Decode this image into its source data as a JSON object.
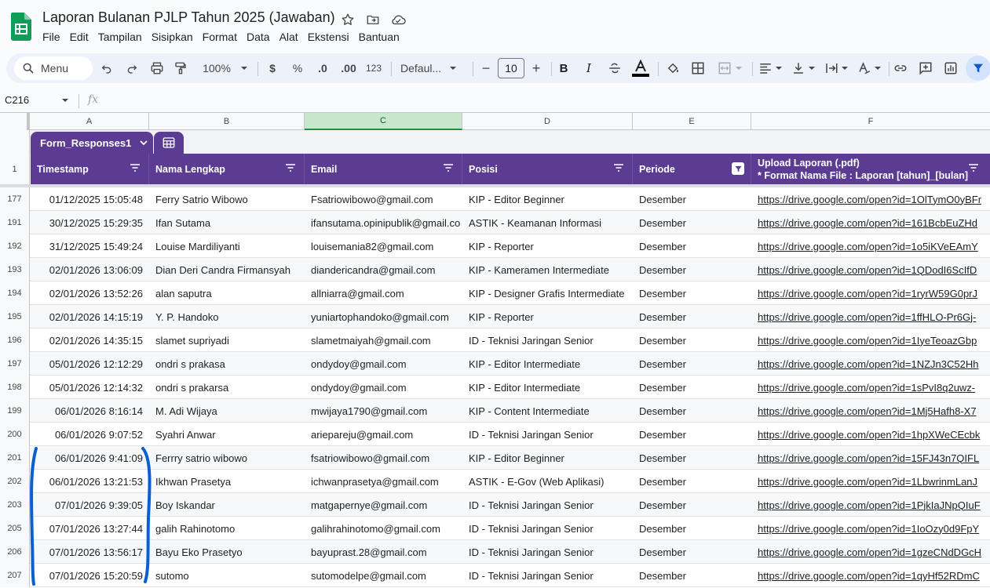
{
  "doc": {
    "title": "Laporan Bulanan PJLP Tahun 2025 (Jawaban)",
    "title_icons": [
      "star-icon",
      "move-folder-icon",
      "cloud-status-icon"
    ]
  },
  "menu": [
    "File",
    "Edit",
    "Tampilan",
    "Sisipkan",
    "Format",
    "Data",
    "Alat",
    "Ekstensi",
    "Bantuan"
  ],
  "toolbar": {
    "search_label": "Menu",
    "zoom": "100%",
    "currency": "$",
    "percent": "%",
    "decrease_decimal": ".0",
    "increase_decimal": ".00",
    "more_formats": "123",
    "font": "Defaul...",
    "font_size": "10",
    "minus": "−",
    "plus": "+",
    "bold": "B",
    "italic": "I"
  },
  "formula_bar": {
    "cell_ref": "C216",
    "fx": "fx",
    "value": ""
  },
  "columns": [
    "A",
    "B",
    "C",
    "D",
    "E",
    "F"
  ],
  "selected_column": "C",
  "table": {
    "name": "Form_Responses1",
    "header_row_number": "1",
    "headers": [
      "Timestamp",
      "Nama Lengkap",
      "Email",
      "Posisi",
      "Periode"
    ],
    "upload_header_line1": "Upload Laporan (.pdf)",
    "upload_header_line2": "* Format Nama File : Laporan [tahun]_[bulan]",
    "filtered_column": "Periode"
  },
  "rows": [
    {
      "n": "177",
      "ts": "01/12/2025 15:05:48",
      "name": "Ferry Satrio Wibowo",
      "email": "Fsatriowibowo@gmail.com",
      "pos": "KIP - Editor Beginner",
      "period": "Desember",
      "link": "https://drive.google.com/open?id=1OlTymO0yBFr"
    },
    {
      "n": "191",
      "ts": "30/12/2025 15:29:35",
      "name": "Ifan Sutama",
      "email": "ifansutama.opinipublik@gmail.co",
      "pos": "ASTIK - Keamanan Informasi",
      "period": "Desember",
      "link": "https://drive.google.com/open?id=161BcbEuZHd"
    },
    {
      "n": "192",
      "ts": "31/12/2025 15:49:24",
      "name": "Louise Mardiliyanti",
      "email": "louisemania82@gmail.com",
      "pos": "KIP - Reporter",
      "period": "Desember",
      "link": "https://drive.google.com/open?id=1o5iKVeEAmY"
    },
    {
      "n": "193",
      "ts": "02/01/2026 13:06:09",
      "name": "Dian Deri Candra Firmansyah",
      "email": "diandericandra@gmail.com",
      "pos": "KIP - Kameramen Intermediate",
      "period": "Desember",
      "link": "https://drive.google.com/open?id=1QDodI6ScIfD"
    },
    {
      "n": "194",
      "ts": "02/01/2026 13:52:26",
      "name": "alan saputra",
      "email": "allniarra@gmail.com",
      "pos": "KIP - Designer Grafis Intermediate",
      "period": "Desember",
      "link": "https://drive.google.com/open?id=1ryrW59G0prJ"
    },
    {
      "n": "195",
      "ts": "02/01/2026 14:15:19",
      "name": "Y. P. Handoko",
      "email": "yuniartophandoko@gmail.com",
      "pos": "KIP - Reporter",
      "period": "Desember",
      "link": "https://drive.google.com/open?id=1ffHLO-Pr6Gj-"
    },
    {
      "n": "196",
      "ts": "02/01/2026 14:35:15",
      "name": "slamet supriyadi",
      "email": "slametmaiyah@gmail.com",
      "pos": "ID - Teknisi Jaringan Senior",
      "period": "Desember",
      "link": "https://drive.google.com/open?id=1IyeTeoazGbp"
    },
    {
      "n": "197",
      "ts": "05/01/2026 12:12:29",
      "name": "ondri s prakasa",
      "email": "ondydoy@gmail.com",
      "pos": "KIP - Editor Intermediate",
      "period": "Desember",
      "link": "https://drive.google.com/open?id=1NZJn3C52Hh"
    },
    {
      "n": "198",
      "ts": "05/01/2026 12:14:32",
      "name": "ondri s prakarsa",
      "email": "ondydoy@gmail.com",
      "pos": "KIP - Editor Intermediate",
      "period": "Desember",
      "link": "https://drive.google.com/open?id=1sPvI8q2uwz-"
    },
    {
      "n": "199",
      "ts": "06/01/2026 8:16:14",
      "name": "M. Adi Wijaya",
      "email": "mwijaya1790@gmail.com",
      "pos": "KIP - Content Intermediate",
      "period": "Desember",
      "link": "https://drive.google.com/open?id=1Mj5Hafh8-X7"
    },
    {
      "n": "200",
      "ts": "06/01/2026 9:07:52",
      "name": "Syahri Anwar",
      "email": "ariepareju@gmail.com",
      "pos": "ID - Teknisi Jaringan Senior",
      "period": "Desember",
      "link": "https://drive.google.com/open?id=1hpXWeCEcbk"
    },
    {
      "n": "201",
      "ts": "06/01/2026 9:41:09",
      "name": "Ferrry satrio wibowo",
      "email": "fsatriowibowo@gmail.com",
      "pos": "KIP - Editor Beginner",
      "period": "Desember",
      "link": "https://drive.google.com/open?id=15FJ43n7QIFL"
    },
    {
      "n": "202",
      "ts": "06/01/2026 13:21:53",
      "name": "Ikhwan Prasetya",
      "email": "ichwanprasetya@gmail.com",
      "pos": "ASTIK - E-Gov (Web Aplikasi)",
      "period": "Desember",
      "link": "https://drive.google.com/open?id=1LbwrinmLanJ"
    },
    {
      "n": "203",
      "ts": "07/01/2026 9:39:05",
      "name": "Boy Iskandar",
      "email": "matgapernye@gmail.com",
      "pos": "ID - Teknisi Jaringan Senior",
      "period": "Desember",
      "link": "https://drive.google.com/open?id=1PjkIaJNpQIuF"
    },
    {
      "n": "205",
      "ts": "07/01/2026 13:27:44",
      "name": "galih Rahinotomo",
      "email": "galihrahinotomo@gmail.com",
      "pos": "ID - Teknisi Jaringan Senior",
      "period": "Desember",
      "link": "https://drive.google.com/open?id=1IoOzy0d9FpY"
    },
    {
      "n": "206",
      "ts": "07/01/2026 13:56:17",
      "name": "Bayu Eko Prasetyo",
      "email": "bayuprast.28@gmail.com",
      "pos": "ID - Teknisi Jaringan Senior",
      "period": "Desember",
      "link": "https://drive.google.com/open?id=1gzeCNdDGcH"
    },
    {
      "n": "207",
      "ts": "07/01/2026 15:20:59",
      "name": "sutomo",
      "email": "sutomodelpe@gmail.com",
      "pos": "ID - Teknisi Jaringan Senior",
      "period": "Desember",
      "link": "https://drive.google.com/open?id=1qyHf52RDmC"
    }
  ],
  "colors": {
    "table_header": "#5b3c92",
    "selected_column_bg": "#c8e6cc",
    "annotation_bracket": "#0b5fd0",
    "sheets_green": "#0f9d58"
  }
}
